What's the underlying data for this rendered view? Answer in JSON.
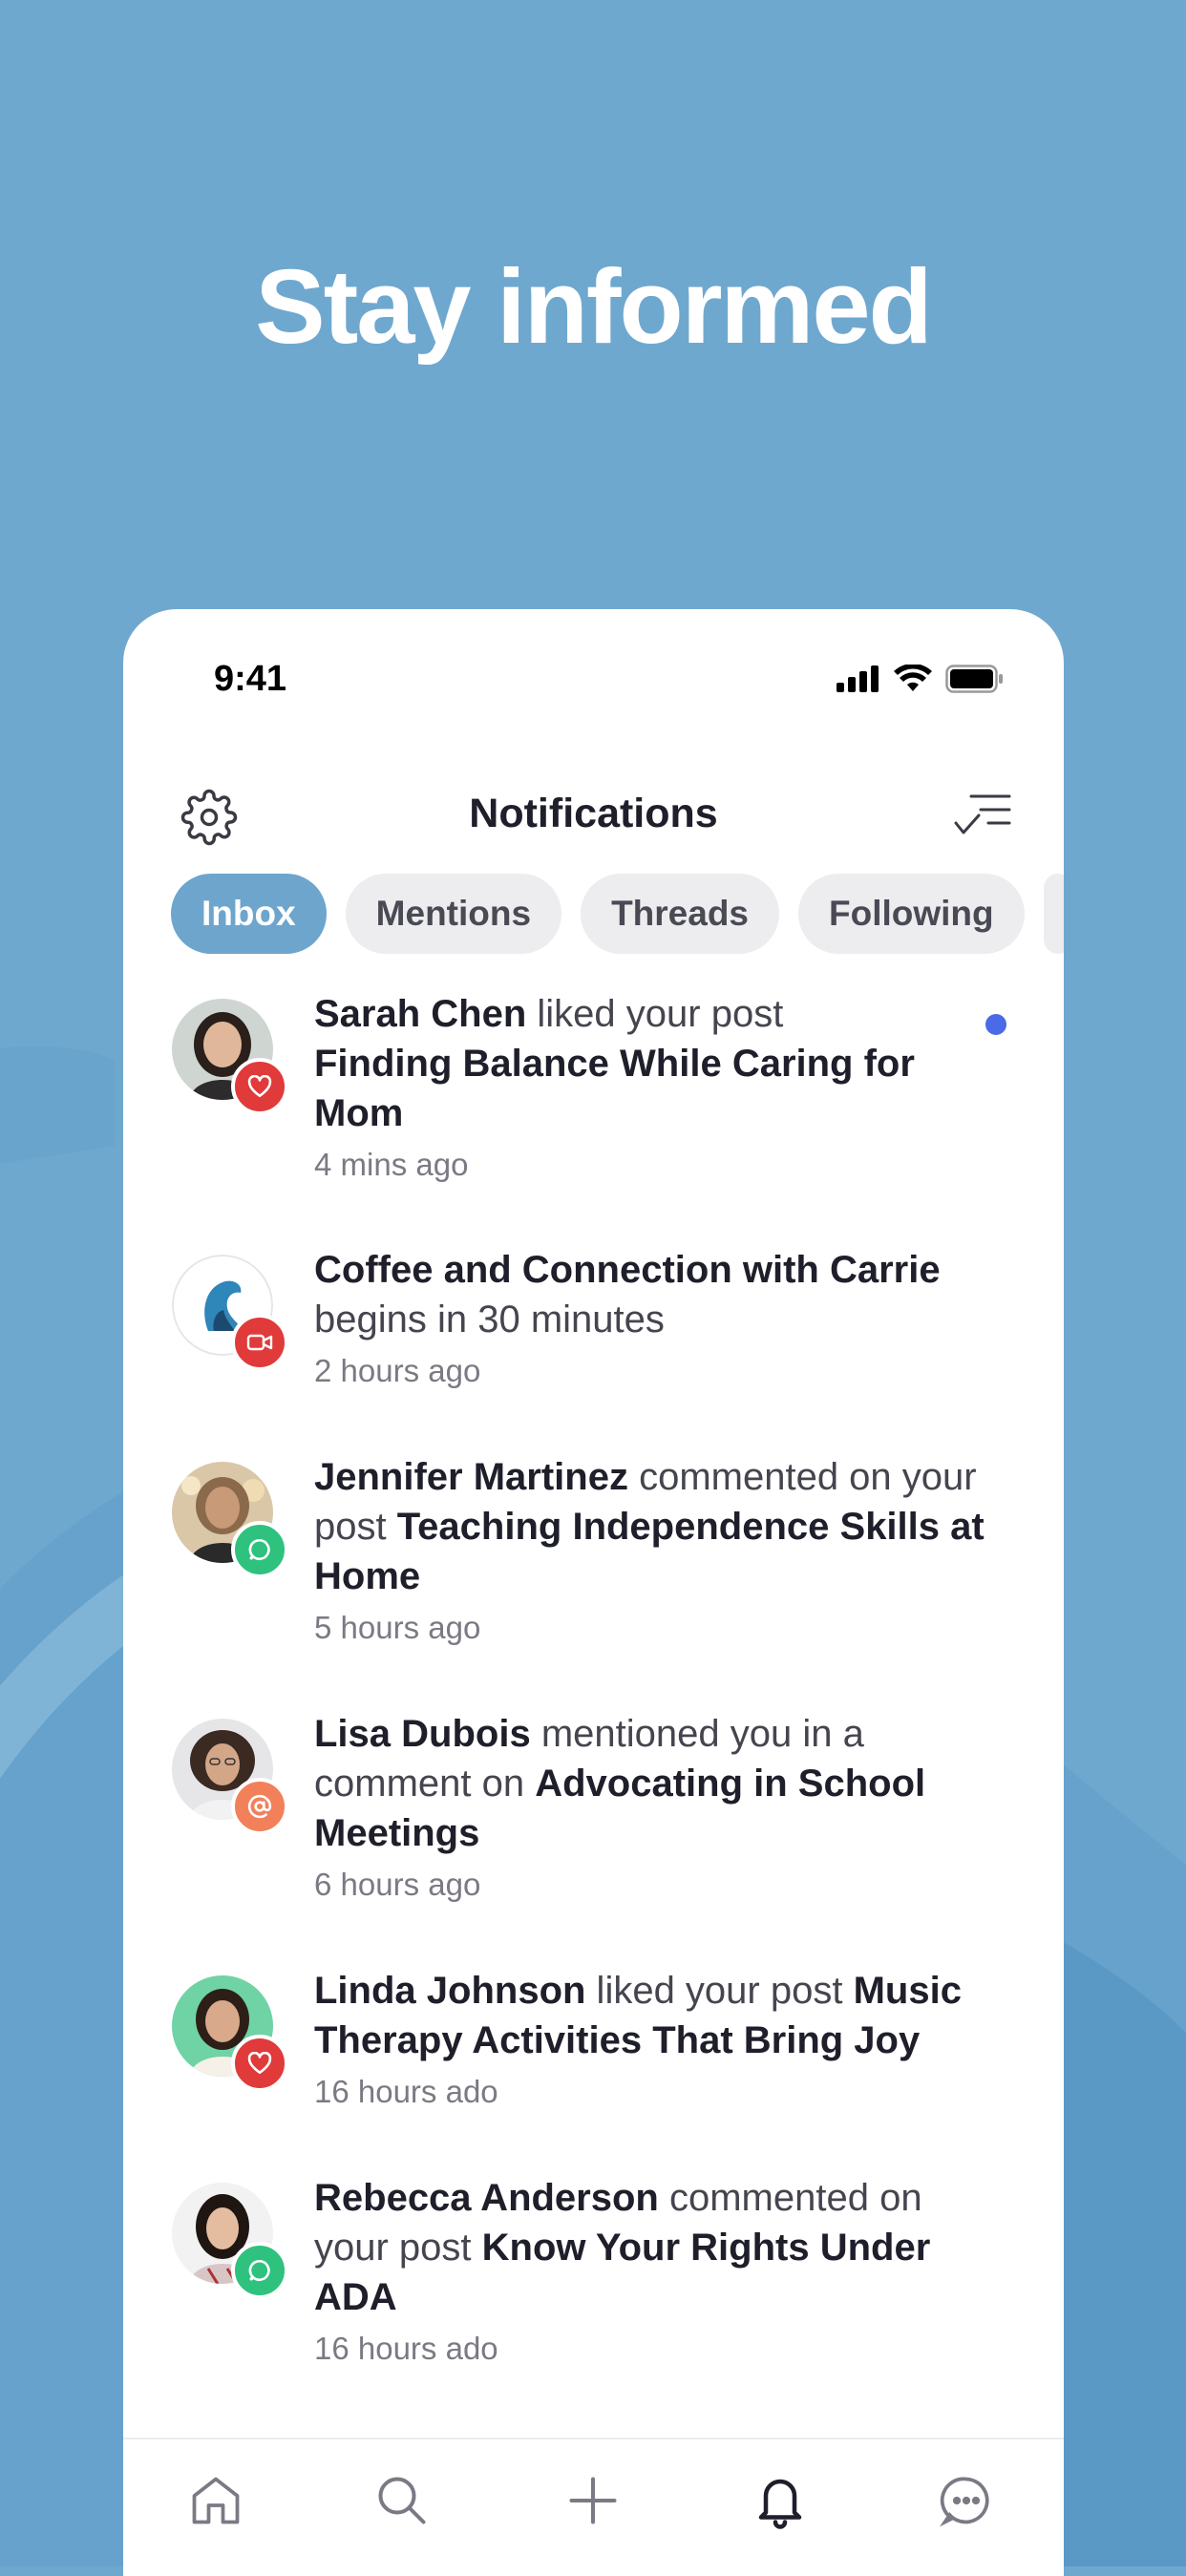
{
  "hero": {
    "title": "Stay informed"
  },
  "status_bar": {
    "time": "9:41"
  },
  "header": {
    "title": "Notifications"
  },
  "tabs": [
    {
      "label": "Inbox",
      "active": true
    },
    {
      "label": "Mentions",
      "active": false
    },
    {
      "label": "Threads",
      "active": false
    },
    {
      "label": "Following",
      "active": false
    }
  ],
  "notifications": [
    {
      "actor": "Sarah Chen",
      "action": " liked your post",
      "subject": "Finding Balance While Caring for Mom",
      "time": "4 mins ago",
      "badge_icon": "heart-icon",
      "badge_color": "#e03a3a",
      "unread": true
    },
    {
      "actor": "",
      "subject_lead": "Coffee and Connection with Carrie",
      "action": " begins in 30 minutes",
      "time": "2 hours ago",
      "badge_icon": "video-icon",
      "badge_color": "#e03a3a",
      "unread": false
    },
    {
      "actor": "Jennifer Martinez",
      "action": " commented on your post ",
      "subject": "Teaching Independence Skills at Home",
      "time": "5 hours ago",
      "badge_icon": "comment-icon",
      "badge_color": "#2ec27e",
      "unread": false
    },
    {
      "actor": "Lisa Dubois",
      "action": " mentioned you in a comment on ",
      "subject": "Advocating in School Meetings",
      "time": "6 hours ago",
      "badge_icon": "at-icon",
      "badge_color": "#f2805a",
      "unread": false
    },
    {
      "actor": "Linda Johnson",
      "action": " liked your post ",
      "subject": "Music Therapy Activities That Bring Joy",
      "time": "16 hours ado",
      "badge_icon": "heart-icon",
      "badge_color": "#e03a3a",
      "unread": false
    },
    {
      "actor": "Rebecca Anderson",
      "action": " commented on your post ",
      "subject": "Know Your Rights Under ADA",
      "time": "16 hours ado",
      "badge_icon": "comment-icon",
      "badge_color": "#2ec27e",
      "unread": false
    }
  ],
  "tabbar": [
    {
      "icon": "home-icon",
      "active": false
    },
    {
      "icon": "search-icon",
      "active": false
    },
    {
      "icon": "plus-icon",
      "active": false
    },
    {
      "icon": "bell-icon",
      "active": true
    },
    {
      "icon": "chat-icon",
      "active": false
    }
  ],
  "colors": {
    "background": "#6fa8cf",
    "accent": "#6ea5cd",
    "unread_dot": "#4a6ae8"
  }
}
